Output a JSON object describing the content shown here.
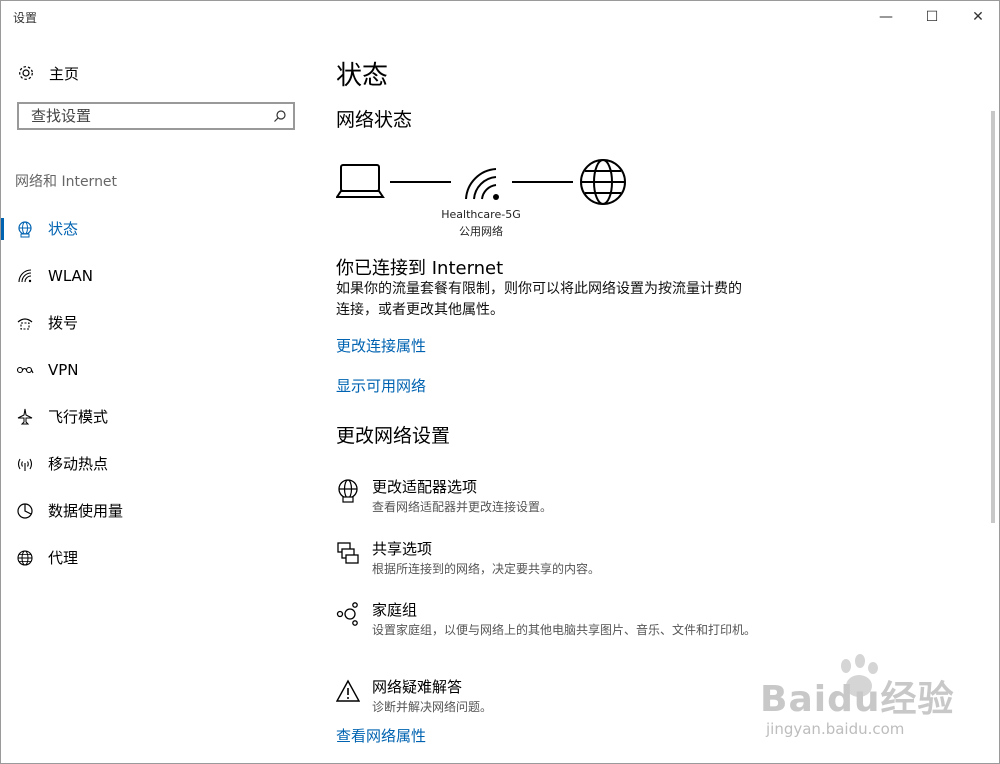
{
  "window": {
    "title": "设置",
    "minimize_symbol": "—",
    "maximize_symbol": "☐",
    "close_symbol": "✕"
  },
  "sidebar": {
    "home": {
      "label": "主页",
      "icon": "gear-icon"
    },
    "search": {
      "placeholder": "查找设置",
      "icon": "search-icon"
    },
    "section_title": "网络和 Internet",
    "items": [
      {
        "label": "状态",
        "icon": "globe-network-icon",
        "active": true
      },
      {
        "label": "WLAN",
        "icon": "wifi-icon"
      },
      {
        "label": "拨号",
        "icon": "dialup-icon"
      },
      {
        "label": "VPN",
        "icon": "vpn-icon"
      },
      {
        "label": "飞行模式",
        "icon": "airplane-icon"
      },
      {
        "label": "移动热点",
        "icon": "hotspot-icon"
      },
      {
        "label": "数据使用量",
        "icon": "data-usage-icon"
      },
      {
        "label": "代理",
        "icon": "globe-icon"
      }
    ]
  },
  "main": {
    "title": "状态",
    "network_status_heading": "网络状态",
    "network_diagram": {
      "network_name": "Healthcare-5G",
      "network_type": "公用网络"
    },
    "connected_title": "你已连接到 Internet",
    "connected_desc": "如果你的流量套餐有限制，则你可以将此网络设置为按流量计费的连接，或者更改其他属性。",
    "links": {
      "change_connection_properties": "更改连接属性",
      "show_available_networks": "显示可用网络",
      "view_network_properties": "查看网络属性"
    },
    "change_settings_heading": "更改网络设置",
    "settings": [
      {
        "title": "更改适配器选项",
        "subtitle": "查看网络适配器并更改连接设置。",
        "icon": "adapter-globe-icon"
      },
      {
        "title": "共享选项",
        "subtitle": "根据所连接到的网络，决定要共享的内容。",
        "icon": "sharing-icon"
      },
      {
        "title": "家庭组",
        "subtitle": "设置家庭组，以便与网络上的其他电脑共享图片、音乐、文件和打印机。",
        "icon": "homegroup-icon"
      },
      {
        "title": "网络疑难解答",
        "subtitle": "诊断并解决网络问题。",
        "icon": "warning-icon"
      }
    ]
  },
  "watermark": {
    "brand": "Baidu经验",
    "url": "jingyan.baidu.com"
  },
  "colors": {
    "accent": "#0063b1",
    "text": "#000000",
    "secondary_text": "#555555"
  }
}
